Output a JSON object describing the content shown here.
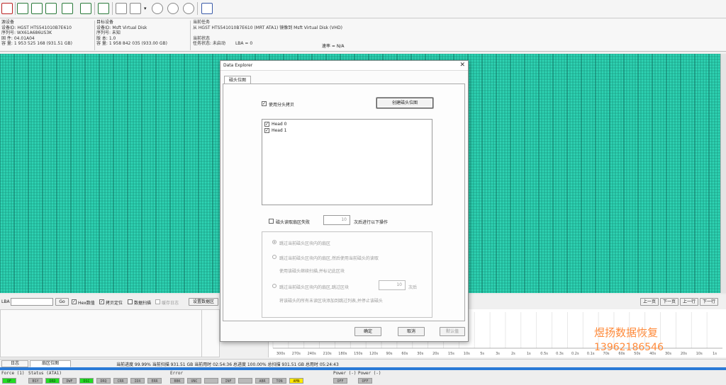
{
  "toolbar": {
    "icons": [
      "plug-icon",
      "save-icon",
      "copy-icon",
      "db-icon",
      "edit-icon",
      "print-icon",
      "tree-icon",
      "filter-icon",
      "disk-icon",
      "dropdown-icon",
      "sync-icon",
      "pause-icon",
      "stop-icon",
      "exit-icon"
    ]
  },
  "source_panel": {
    "title": "源设备",
    "lines": [
      "设备ID: HGST HTS541010B7E610",
      "序列号: WX61A686US3K",
      "固  件: 04.01A04",
      "容  量: 1 953 525 168 (931.51 GB)"
    ]
  },
  "target_panel": {
    "title": "目标设备",
    "lines": [
      "设备ID: Msft Virtual Disk",
      "序列号: 未知",
      "版  本: 1.0",
      "容  量: 1 958 842 035 (933.00 GB)"
    ]
  },
  "task_panel": {
    "title": "当前任务",
    "line1": "从 HGST HTS541010B7E610 (MRT ATA1) 镜像到 Msft Virtual Disk (VHD)",
    "status_title": "当前状态",
    "status_line": "任务状态: 未启动",
    "lba_label": "LBA = 0",
    "speed_label": "速率 = N/A"
  },
  "lba_bar": {
    "label": "LBA",
    "go_button": "Go",
    "hex_label": "Hex数值",
    "copy_label": "拷贝定位",
    "read_label": "数据扫描",
    "reserved_label": "缓存日志",
    "settings_label": "设置数据区",
    "nav": [
      "上一页",
      "下一页",
      "上一行",
      "下一行"
    ]
  },
  "watermark": {
    "name": "煜扬数据恢复",
    "phone": "13962186546"
  },
  "progress_line": "当前进度 99.99% 当前扫描 931.51 GB 当前用时 02:54:36    总进度 100.00% 总扫描 931.51 GB 总用时 05:24:43",
  "bottom_tabs": [
    "日志",
    "扇区位图"
  ],
  "status_bar": {
    "force_label": "Force (1)",
    "force_items": [
      {
        "label": "OF",
        "state": "green"
      }
    ],
    "status_label": "Status (ATA1)",
    "status_items": [
      {
        "label": "BSY",
        "state": "gray"
      },
      {
        "label": "DRD",
        "state": "green"
      },
      {
        "label": "DWF",
        "state": "gray"
      },
      {
        "label": "DSC",
        "state": "green"
      },
      {
        "label": "DRQ",
        "state": "gray"
      },
      {
        "label": "CRR",
        "state": "gray"
      },
      {
        "label": "IDX",
        "state": "gray"
      },
      {
        "label": "ERR",
        "state": "gray"
      }
    ],
    "error_label": "Error",
    "error_items": [
      {
        "label": "BBK",
        "state": "gray"
      },
      {
        "label": "UNC",
        "state": "gray"
      },
      {
        "label": "",
        "state": "gray"
      },
      {
        "label": "INF",
        "state": "gray"
      },
      {
        "label": "",
        "state": "gray"
      },
      {
        "label": "ABR",
        "state": "gray"
      },
      {
        "label": "TON",
        "state": "gray"
      },
      {
        "label": "AMN",
        "state": "yellow"
      }
    ],
    "power_label1": "Power (-)",
    "power_items1": [
      {
        "label": "OFF",
        "state": "gray"
      }
    ],
    "power_label2": "Power (-)",
    "power_items2": [
      {
        "label": "OFF",
        "state": "gray"
      }
    ]
  },
  "dialog": {
    "title": "Data Explorer",
    "tab": "磁头位图",
    "use_head_map": "使用分头拷贝",
    "create_button": "创建磁头位图",
    "heads": [
      {
        "label": "Head 0",
        "checked": true
      },
      {
        "label": "Head 1",
        "checked": true
      }
    ],
    "fail_label": "磁头读取扇区失败",
    "fail_count": "10",
    "fail_suffix": "次后进行以下操作",
    "opt1": "跳过当前磁头区块内的扇区",
    "opt2": "跳过当前磁头区块内的扇区,然后使用当前磁头的读取",
    "opt2_sub": "使用该磁头继续扫描,并标记此区块",
    "opt3": "跳过当前磁头区块内的扇区,跳过区块",
    "opt3_count": "10",
    "opt3_suffix": "次后",
    "opt3_sub": "将该磁头的所有未读区块添加到跳过列表,并停止该磁头",
    "ok_button": "确定",
    "cancel_button": "取消",
    "default_button": "默认值"
  },
  "chart_data": {
    "type": "bar",
    "title": "",
    "xlabel": "",
    "ylabel": "",
    "categories": [
      "300s",
      "270s",
      "240s",
      "210s",
      "180s",
      "150s",
      "120s",
      "90s",
      "60s",
      "30s",
      "20s",
      "15s",
      "10s",
      "5s",
      "3s",
      "2s",
      "1s",
      "0.5s",
      "0.3s",
      "0.2s",
      "0.1s",
      "70s",
      "60s",
      "50s",
      "40s",
      "30s",
      "20s",
      "10s",
      "1s"
    ],
    "values": [
      0,
      0,
      0,
      0,
      0,
      0,
      0,
      0,
      0,
      0,
      0,
      0,
      0,
      0,
      0,
      0,
      0,
      0,
      0,
      0,
      0,
      0,
      0,
      0,
      0,
      0,
      0,
      0,
      0
    ],
    "grid": true,
    "legend": "none"
  },
  "colors": {
    "map_fill": "#2fd4b4",
    "map_cell": "#40e0c0",
    "map_line": "#148c76",
    "accent_blue": "#2a7ad6",
    "watermark": "#ff8a3a"
  }
}
